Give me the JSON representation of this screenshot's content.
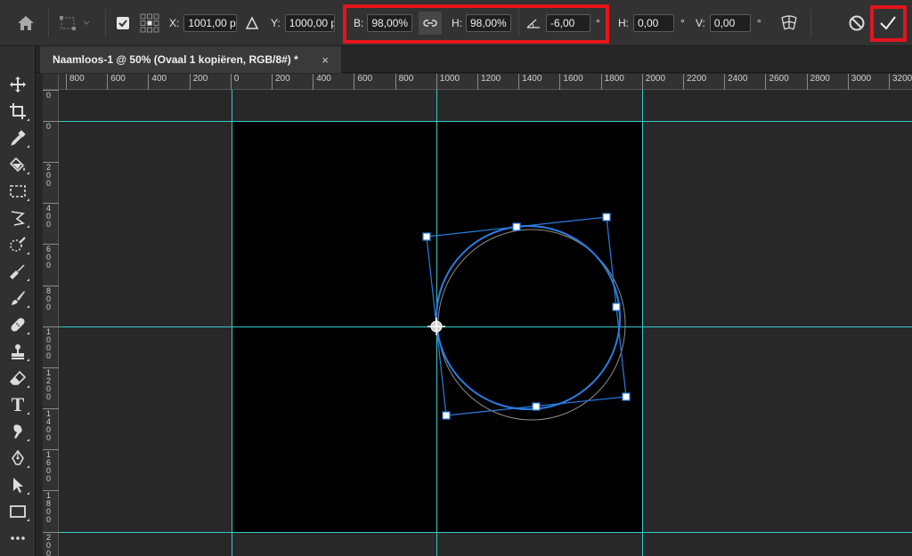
{
  "options_bar": {
    "x_label": "X:",
    "x_value": "1001,00 p",
    "y_label": "Y:",
    "y_value": "1000,00 p",
    "b_label": "B:",
    "b_value": "98,00%",
    "h_label": "H:",
    "h_value": "98,00%",
    "angle_value": "-6,00",
    "angle_unit": "°",
    "skew_h_label": "H:",
    "skew_h_value": "0,00",
    "skew_h_unit": "°",
    "skew_v_label": "V:",
    "skew_v_value": "0,00",
    "skew_v_unit": "°",
    "highlight_color": "#e5141c"
  },
  "document": {
    "tab_title": "Naamloos-1 @ 50% (Ovaal 1 kopiëren, RGB/8#) *",
    "close_glyph": "×"
  },
  "toolbar": {
    "expand_glyph": "»",
    "tools": [
      "move-icon",
      "crop-icon",
      "eyedropper-icon",
      "paint-bucket-icon",
      "marquee-icon",
      "lasso-icon",
      "quick-selection-icon",
      "spot-healing-icon",
      "brush-icon",
      "healing-brush-icon",
      "stamp-icon",
      "eraser-icon",
      "type-icon",
      "smudge-icon",
      "pen-icon",
      "path-selection-icon",
      "rectangle-icon",
      "more-tools-icon"
    ],
    "type_glyph": "T"
  },
  "ruler": {
    "h_labels": [
      "800",
      "600",
      "400",
      "200",
      "0",
      "200",
      "400",
      "600",
      "800",
      "1000",
      "1200",
      "1400",
      "1600",
      "1800",
      "2000",
      "2200",
      "2400",
      "2600",
      "2800",
      "3000",
      "3200"
    ],
    "v_labels": [
      "0",
      "0",
      "200",
      "400",
      "600",
      "800",
      "1000",
      "1200",
      "1400",
      "1600",
      "1800",
      "2000"
    ]
  },
  "colors": {
    "guide": "#33cccc",
    "bbox": "#2a7de1",
    "ellipse_ghost": "#8c8c8c"
  }
}
